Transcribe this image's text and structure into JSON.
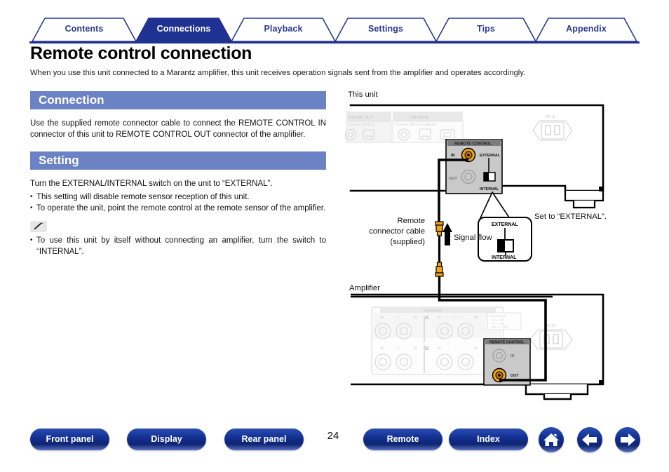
{
  "tabs": [
    {
      "label": "Contents",
      "active": false
    },
    {
      "label": "Connections",
      "active": true
    },
    {
      "label": "Playback",
      "active": false
    },
    {
      "label": "Settings",
      "active": false
    },
    {
      "label": "Tips",
      "active": false
    },
    {
      "label": "Appendix",
      "active": false
    }
  ],
  "page": {
    "title": "Remote control connection",
    "intro": "When you use this unit connected to a Marantz amplifier, this unit receives operation signals sent from the amplifier and operates accordingly.",
    "number": "24"
  },
  "sections": [
    {
      "heading": "Connection",
      "paragraph": "Use the supplied remote connector cable to connect the REMOTE CONTROL IN connector of this unit to REMOTE CONTROL OUT connector of the amplifier."
    },
    {
      "heading": "Setting",
      "paragraph": "Turn the EXTERNAL/INTERNAL switch on the unit to “EXTERNAL”.",
      "bullets": [
        "This setting will disable remote sensor reception of this unit.",
        "To operate the unit, point the remote control at the remote sensor of the amplifier."
      ],
      "note_bullets": [
        "To use this unit by itself without connecting an amplifier, turn the switch to “INTERNAL”."
      ]
    }
  ],
  "diagram": {
    "unit_label": "This unit",
    "amp_label": "Amplifier",
    "cable_label_line1": "Remote",
    "cable_label_line2": "connector cable",
    "cable_label_line3": "(supplied)",
    "signal_flow_label": "Signal flow",
    "callout_text": "Set to “EXTERNAL”.",
    "callout_top": "EXTERNAL",
    "callout_bottom": "INTERNAL",
    "unit_panel": {
      "remote_block_title": "REMOTE CONTROL",
      "jack_in": "IN",
      "jack_out": "OUT",
      "switch_top": "EXTERNAL",
      "switch_bottom": "INTERNAL",
      "ac_in": "AC IN",
      "digital_out_title": "DIGITAL OUT",
      "digital_in_title": "DIGITAL IN",
      "digital_out_sub": "COAXIAL  OPTICAL",
      "digital_in_sub": "COAXIAL  OPTICAL  USB/DAC"
    },
    "amp_panel": {
      "speakers_title": "SPEAKERS",
      "zone_a": "A",
      "zone_b": "B",
      "impedance_title": "IMPEDANCE",
      "impedance_lines": [
        "A  ÷– : 8Ω",
        "B  ÷– : 8Ω",
        "A+B ÷– : 16Ω"
      ],
      "remote_block_title": "REMOTE CONTROL",
      "jack_in": "IN",
      "jack_out": "OUT",
      "ac_in": "AC IN"
    }
  },
  "footer": {
    "buttons": [
      {
        "label": "Front panel"
      },
      {
        "label": "Display"
      },
      {
        "label": "Rear panel"
      },
      {
        "label": "Remote"
      },
      {
        "label": "Index"
      }
    ],
    "icons": [
      {
        "name": "home-icon"
      },
      {
        "name": "back-arrow-icon"
      },
      {
        "name": "forward-arrow-icon"
      }
    ]
  },
  "colors": {
    "tab_active": "#1F3191",
    "tab_text": "#2B3990",
    "section_bar": "#6B82C4",
    "button_blue": "#123093",
    "connector_gold": "#F0A11E"
  }
}
